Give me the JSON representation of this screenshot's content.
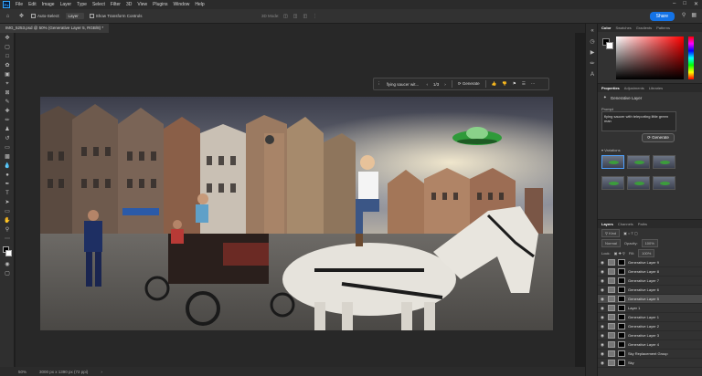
{
  "menubar": {
    "logo": "Ps",
    "items": [
      "File",
      "Edit",
      "Image",
      "Layer",
      "Type",
      "Select",
      "Filter",
      "3D",
      "View",
      "Plugins",
      "Window",
      "Help"
    ]
  },
  "options": {
    "auto_select_label": "Auto-Select:",
    "auto_select_value": "Layer",
    "transform_label": "Show Transform Controls",
    "three_d_label": "3D Mode:",
    "share_label": "Share"
  },
  "document": {
    "tab_title": "IMG_5253.psd @ 50% (Generative Layer 5, RGB/8) *"
  },
  "context_bar": {
    "prompt": "flying saucer wit...",
    "counter": "1/3",
    "generate_label": "Generate"
  },
  "status": {
    "zoom": "50%",
    "doc_size": "3000 px x 1390 px (72 ppi)"
  },
  "color_panel": {
    "tabs": [
      "Color",
      "Swatches",
      "Gradients",
      "Patterns"
    ],
    "fg_color": "#000000",
    "bg_color": "#ffffff"
  },
  "properties": {
    "tabs": [
      "Properties",
      "Adjustments",
      "Libraries"
    ],
    "layer_type": "Generative Layer",
    "prompt_label": "Prompt",
    "prompt_text": "flying saucer with teleporting little green man",
    "generate_label": "Generate",
    "variations_label": "Variations"
  },
  "layers": {
    "tabs": [
      "Layers",
      "Channels",
      "Paths"
    ],
    "kind_label": "Kind",
    "blend_mode": "Normal",
    "opacity_label": "Opacity:",
    "opacity": "100%",
    "lock_label": "Lock:",
    "fill_label": "Fill:",
    "fill": "100%",
    "rows": [
      {
        "name": "Generative Layer 9",
        "active": false
      },
      {
        "name": "Generative Layer 8",
        "active": false
      },
      {
        "name": "Generative Layer 7",
        "active": false
      },
      {
        "name": "Generative Layer 6",
        "active": false
      },
      {
        "name": "Generative Layer 5",
        "active": true
      },
      {
        "name": "Layer 1",
        "active": false
      },
      {
        "name": "Generative Layer 1",
        "active": false
      },
      {
        "name": "Generative Layer 2",
        "active": false
      },
      {
        "name": "Generative Layer 3",
        "active": false
      },
      {
        "name": "Generative Layer 4",
        "active": false
      },
      {
        "name": "Sky Replacement Group",
        "active": false
      },
      {
        "name": "Sky",
        "active": false
      }
    ]
  }
}
